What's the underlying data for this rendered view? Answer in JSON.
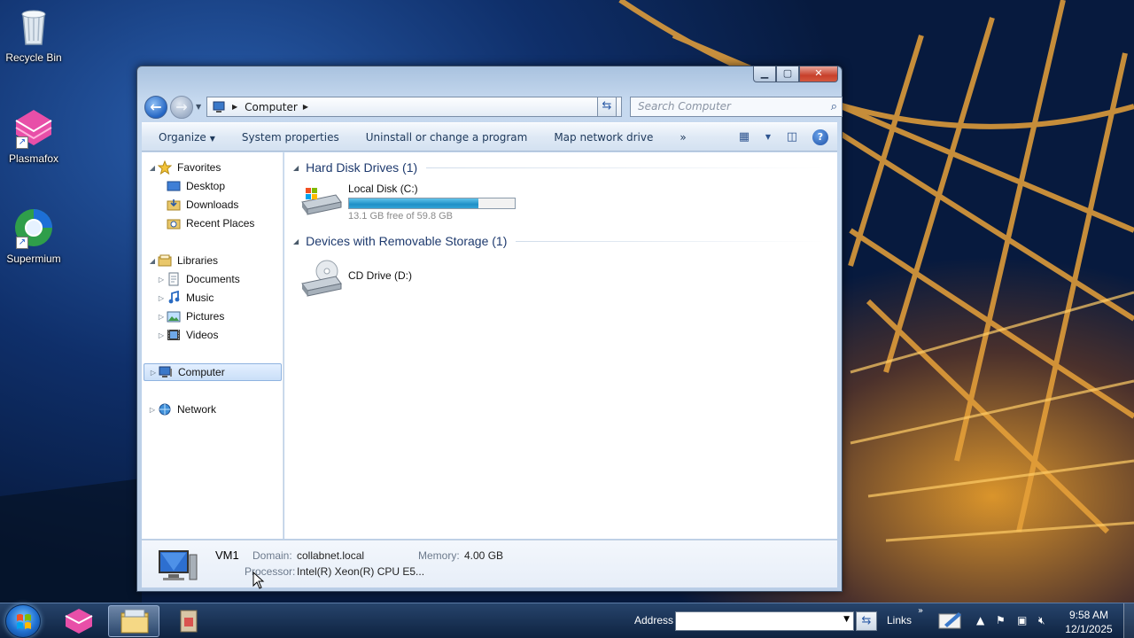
{
  "desktop": {
    "icons": [
      {
        "label": "Recycle Bin"
      },
      {
        "label": "Plasmafox"
      },
      {
        "label": "Supermium"
      }
    ]
  },
  "window": {
    "address": {
      "location": "Computer"
    },
    "search": {
      "placeholder": "Search Computer"
    },
    "commands": {
      "organize": "Organize",
      "system_properties": "System properties",
      "uninstall": "Uninstall or change a program",
      "map_drive": "Map network drive",
      "more": "»"
    },
    "nav": {
      "favorites": "Favorites",
      "desktop": "Desktop",
      "downloads": "Downloads",
      "recent_places": "Recent Places",
      "libraries": "Libraries",
      "documents": "Documents",
      "music": "Music",
      "pictures": "Pictures",
      "videos": "Videos",
      "computer": "Computer",
      "network": "Network"
    },
    "groups": {
      "hard_disk": {
        "title": "Hard Disk Drives (1)",
        "drive_name": "Local Disk (C:)",
        "free_text": "13.1 GB free of 59.8 GB",
        "used_fraction": 0.78
      },
      "removable": {
        "title": "Devices with Removable Storage (1)",
        "drive_name": "CD Drive (D:)"
      }
    },
    "details": {
      "name": "VM1",
      "domain_label": "Domain:",
      "domain_value": "collabnet.local",
      "memory_label": "Memory:",
      "memory_value": "4.00 GB",
      "processor_label": "Processor:",
      "processor_value": "Intel(R) Xeon(R) CPU E5..."
    }
  },
  "taskbar": {
    "address_label": "Address",
    "address_value": "",
    "links_label": "Links",
    "links_more": "»",
    "clock_time": "9:58 AM",
    "clock_date": "12/1/2025"
  },
  "colors": {
    "accent": "#1e3a6e",
    "disk_fill": "#1f8fc7",
    "close_button": "#c7402b"
  }
}
